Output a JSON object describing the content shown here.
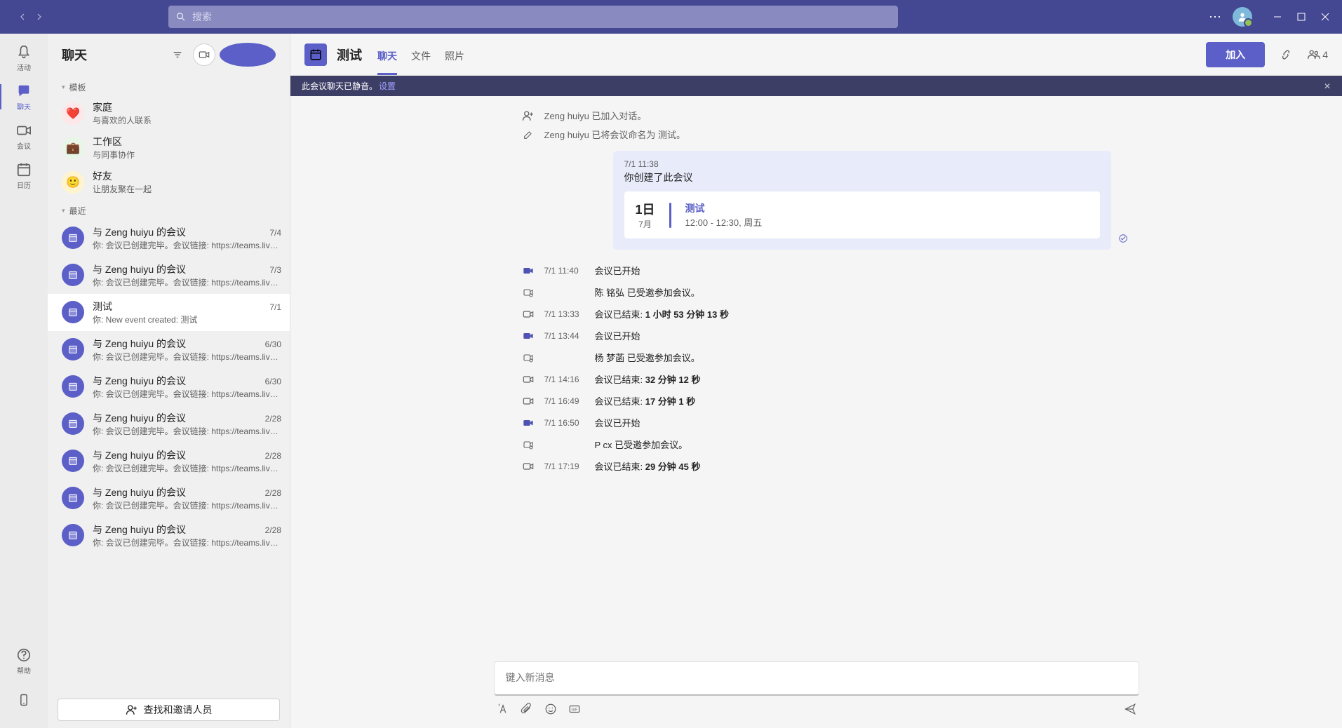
{
  "titlebar": {
    "search_placeholder": "搜索"
  },
  "rail": {
    "activity": "活动",
    "chat": "聊天",
    "meetings": "会议",
    "calendar": "日历",
    "help": "帮助"
  },
  "chatlist": {
    "title": "聊天",
    "section_templates": "模板",
    "templates": [
      {
        "name": "家庭",
        "sub": "与喜欢的人联系",
        "emoji": "❤️",
        "bg": "#fde7e9"
      },
      {
        "name": "工作区",
        "sub": "与同事协作",
        "emoji": "💼",
        "bg": "#e7f6e7"
      },
      {
        "name": "好友",
        "sub": "让朋友聚在一起",
        "emoji": "🙂",
        "bg": "#fff4ce"
      }
    ],
    "section_recent": "最近",
    "recent": [
      {
        "title": "与 Zeng huiyu 的会议",
        "date": "7/4",
        "preview": "你: 会议已创建完毕。会议链接: https://teams.live...."
      },
      {
        "title": "与 Zeng huiyu 的会议",
        "date": "7/3",
        "preview": "你: 会议已创建完毕。会议链接: https://teams.live...."
      },
      {
        "title": "测试",
        "date": "7/1",
        "preview": "你: New event created: 测试",
        "selected": true
      },
      {
        "title": "与 Zeng huiyu 的会议",
        "date": "6/30",
        "preview": "你: 会议已创建完毕。会议链接: https://teams.live...."
      },
      {
        "title": "与 Zeng huiyu 的会议",
        "date": "6/30",
        "preview": "你: 会议已创建完毕。会议链接: https://teams.live...."
      },
      {
        "title": "与 Zeng huiyu 的会议",
        "date": "2/28",
        "preview": "你: 会议已创建完毕。会议链接: https://teams.live...."
      },
      {
        "title": "与 Zeng huiyu 的会议",
        "date": "2/28",
        "preview": "你: 会议已创建完毕。会议链接: https://teams.live...."
      },
      {
        "title": "与 Zeng huiyu 的会议",
        "date": "2/28",
        "preview": "你: 会议已创建完毕。会议链接: https://teams.live...."
      },
      {
        "title": "与 Zeng huiyu 的会议",
        "date": "2/28",
        "preview": "你: 会议已创建完毕。会议链接: https://teams.live...."
      }
    ],
    "invite_label": "查找和邀请人员"
  },
  "main": {
    "title": "测试",
    "tabs": {
      "chat": "聊天",
      "files": "文件",
      "photos": "照片"
    },
    "join_label": "加入",
    "participant_count": "4",
    "banner": {
      "text": "此会议聊天已静音。",
      "link": "设置"
    },
    "system_messages": [
      "Zeng huiyu 已加入对话。",
      "Zeng huiyu 已将会议命名为 测试。"
    ],
    "meeting_card": {
      "timestamp": "7/1 11:38",
      "created_text": "你创建了此会议",
      "day": "1日",
      "month": "7月",
      "name": "测试",
      "time_range": "12:00 - 12:30, 周五"
    },
    "events": [
      {
        "type": "vid",
        "time": "7/1 11:40",
        "text": "会议已开始"
      },
      {
        "type": "join",
        "time": "",
        "text": "陈 铭弘 已受邀参加会议。"
      },
      {
        "type": "end",
        "time": "7/1 13:33",
        "text": "会议已结束: 1 小时 53 分钟 13 秒"
      },
      {
        "type": "vid",
        "time": "7/1 13:44",
        "text": "会议已开始"
      },
      {
        "type": "join",
        "time": "",
        "text": "杨 梦菡 已受邀参加会议。"
      },
      {
        "type": "end",
        "time": "7/1 14:16",
        "text": "会议已结束: 32 分钟 12 秒"
      },
      {
        "type": "end",
        "time": "7/1 16:49",
        "text": "会议已结束: 17 分钟 1 秒"
      },
      {
        "type": "vid",
        "time": "7/1 16:50",
        "text": "会议已开始"
      },
      {
        "type": "join",
        "time": "",
        "text": "P cx 已受邀参加会议。"
      },
      {
        "type": "end",
        "time": "7/1 17:19",
        "text": "会议已结束: 29 分钟 45 秒"
      }
    ],
    "compose_placeholder": "键入新消息"
  }
}
